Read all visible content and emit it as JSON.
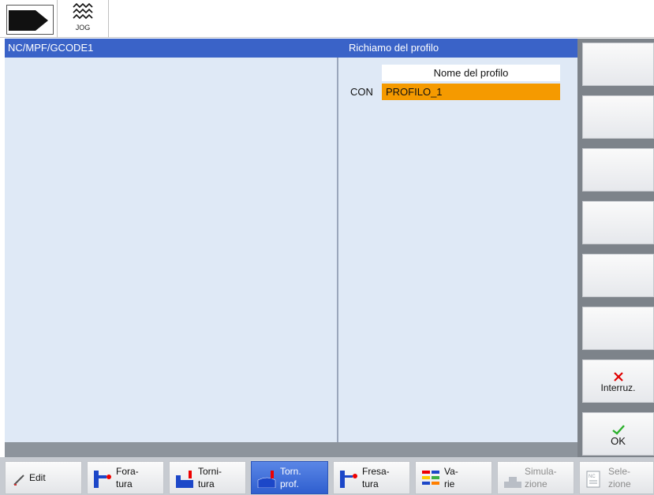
{
  "topbar": {
    "jog_label": "JOG"
  },
  "titlebar": {
    "left": "NC/MPF/GCODE1",
    "right": "Richiamo del profilo"
  },
  "form": {
    "header": "Nome del profilo",
    "con_label": "CON",
    "profile_value": "PROFILO_1"
  },
  "vertical_softkeys": [
    {
      "label": "",
      "enabled": true
    },
    {
      "label": "",
      "enabled": true
    },
    {
      "label": "",
      "enabled": true
    },
    {
      "label": "",
      "enabled": true
    },
    {
      "label": "",
      "enabled": true
    },
    {
      "label": "",
      "enabled": true
    },
    {
      "label": "Interruz.",
      "icon": "cancel-x-icon"
    },
    {
      "label": "OK",
      "icon": "ok-check-icon"
    }
  ],
  "horizontal_softkeys": [
    {
      "line1": "Edit",
      "line2": "",
      "icon": "edit-pencil-icon",
      "state": "normal"
    },
    {
      "line1": "Fora-",
      "line2": "tura",
      "icon": "drilling-icon",
      "state": "normal"
    },
    {
      "line1": "Torni-",
      "line2": "tura",
      "icon": "turning-icon",
      "state": "normal"
    },
    {
      "line1": "Torn.",
      "line2": "prof.",
      "icon": "contour-turning-icon",
      "state": "active"
    },
    {
      "line1": "Fresa-",
      "line2": "tura",
      "icon": "milling-icon",
      "state": "normal"
    },
    {
      "line1": "Va-",
      "line2": "rie",
      "icon": "various-icon",
      "state": "normal"
    },
    {
      "line1": "Simula-",
      "line2": "zione",
      "icon": "simulation-icon",
      "state": "disabled"
    },
    {
      "line1": "Sele-",
      "line2": "zione",
      "icon": "nc-select-icon",
      "state": "disabled"
    }
  ],
  "colors": {
    "title_bar": "#3a63c8",
    "editor_bg": "#dfe9f6",
    "selected_field": "#f59a00",
    "active_softkey": "#2f5fcf"
  }
}
